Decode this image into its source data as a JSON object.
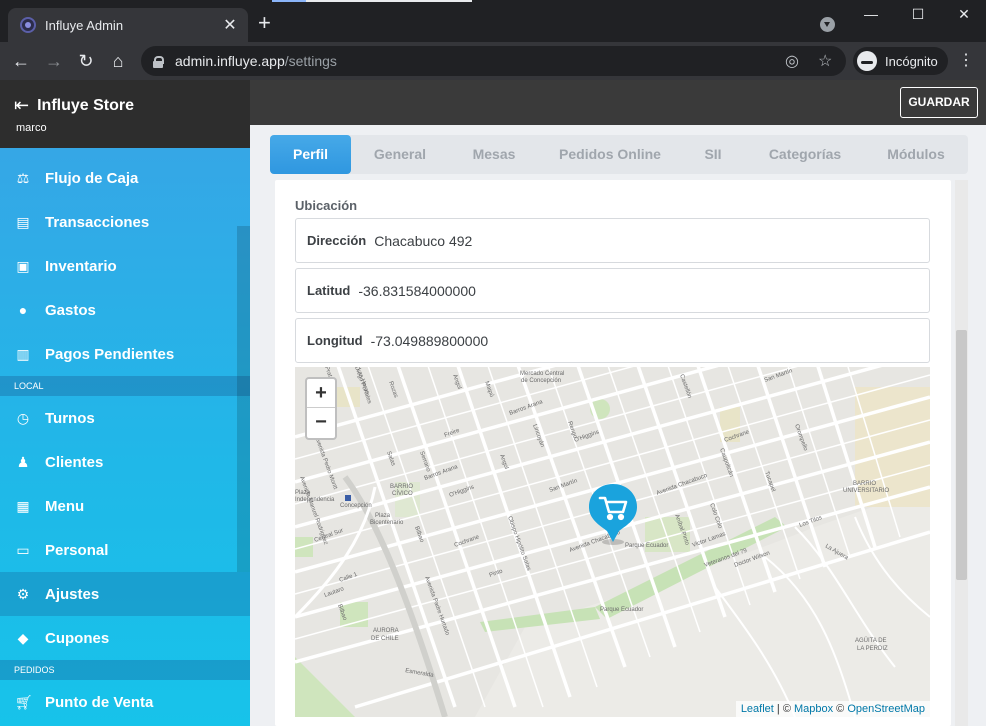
{
  "browser": {
    "tab_title": "Influye Admin",
    "url_host": "admin.influye.app",
    "url_path": "/settings",
    "incognito_label": "Incógnito"
  },
  "sidebar": {
    "title": "Influye Store",
    "user": "marco",
    "items": [
      {
        "label": "Flujo de Caja",
        "icon": "scale-icon"
      },
      {
        "label": "Transacciones",
        "icon": "receipt-icon"
      },
      {
        "label": "Inventario",
        "icon": "box-icon"
      },
      {
        "label": "Gastos",
        "icon": "money-bag-icon"
      },
      {
        "label": "Pagos Pendientes",
        "icon": "clipboard-icon"
      }
    ],
    "section_local": "LOCAL",
    "local_items": [
      {
        "label": "Turnos",
        "icon": "clock-icon"
      },
      {
        "label": "Clientes",
        "icon": "users-icon"
      },
      {
        "label": "Menu",
        "icon": "menu-book-icon"
      },
      {
        "label": "Personal",
        "icon": "id-card-icon"
      },
      {
        "label": "Ajustes",
        "icon": "gear-icon"
      },
      {
        "label": "Cupones",
        "icon": "ticket-icon"
      }
    ],
    "section_pedidos": "PEDIDOS",
    "pedidos_items": [
      {
        "label": "Punto de Venta",
        "icon": "cart-icon"
      }
    ]
  },
  "topbar": {
    "save_label": "GUARDAR"
  },
  "tabs": [
    "Perfil",
    "General",
    "Mesas",
    "Pedidos Online",
    "SII",
    "Categorías",
    "Módulos"
  ],
  "location": {
    "section_title": "Ubicación",
    "address_label": "Dirección",
    "address_value": "Chacabuco 492",
    "lat_label": "Latitud",
    "lat_value": "-36.831584000000",
    "lng_label": "Longitud",
    "lng_value": "-73.049889800000"
  },
  "map": {
    "zoom_in": "+",
    "zoom_out": "−",
    "attribution_leaflet": "Leaflet",
    "attribution_sep1": " | © ",
    "attribution_mapbox": "Mapbox",
    "attribution_sep2": " © ",
    "attribution_osm": "OpenStreetMap",
    "labels": [
      "Mercado Central de Concepción",
      "BARRIO UNIVERSITARIO",
      "BARRIO CÍVICO",
      "AURORA DE CHILE",
      "AGÜITA DE LA PERDIZ",
      "Parque Ecuador",
      "Concepción",
      "Plaza Independencia",
      "Avenida Chacabuco",
      "Victor Lamas",
      "Cochrane",
      "San Martín",
      "O'Higgins",
      "Barros Arana",
      "Freire",
      "Maipú",
      "Castellón",
      "Tucapel",
      "Orompello",
      "Lincoyán",
      "Rengo",
      "Colo Colo",
      "Caupolicán",
      "Aníbal Pinto",
      "Serrano",
      "Salas",
      "Bilbao",
      "Angol",
      "Rozas",
      "Las Heras",
      "Prat",
      "Esmeralda",
      "Los Tilos",
      "La Ajuera",
      "Diego Portales",
      "Veteranos del 79",
      "Doctor Wilson",
      "Obispo Hipólito Salas",
      "Avenida Padre Hurtado",
      "Avenida Pedro Montt",
      "Avenida Manuel Rodríguez",
      "Central Sur",
      "Calle 1",
      "Pinto",
      "Lautaro",
      "Plaza Bicentenario",
      "Parque Ecuador"
    ]
  },
  "colors": {
    "accent": "#2f97e0",
    "sidebar_top": "#3aa3e6",
    "sidebar_bottom": "#17c3ea",
    "marker": "#1aa3dd",
    "topbar": "#3a3a3a"
  }
}
